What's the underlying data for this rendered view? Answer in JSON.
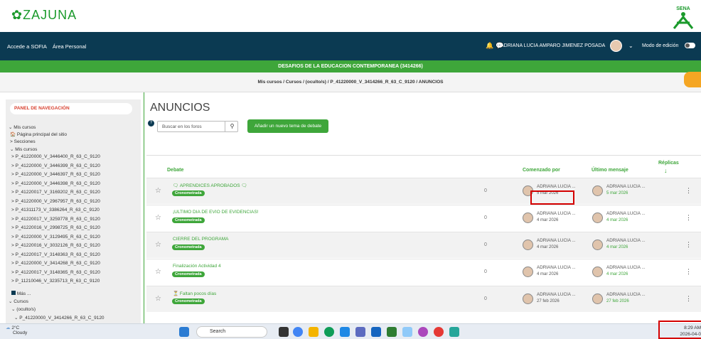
{
  "logo": {
    "text": "ZAJUNA",
    "sena_label": "SENA"
  },
  "topnav": {
    "link1": "Accede a SOFIA",
    "link2": "Área Personal",
    "user": "ADRIANA LUCIA AMPARO JIMENEZ POSADA",
    "edit_mode": "Modo de edición"
  },
  "course_title": "DESAFIOS DE LA EDUCACION CONTEMPORANEA (3414266)",
  "breadcrumb": "Mis cursos / Cursos / (oculto/s) / P_41220000_V_3414266_R_63_C_9120 / ANUNCIOS",
  "sidebar": {
    "title": "PANEL DE NAVEGACIÓN",
    "my_courses": "Mis cursos",
    "home": "Página principal del sitio",
    "sections": "Secciones",
    "my_courses2": "Mis cursos",
    "courses": [
      "P_41220000_V_3446400_R_63_C_9120",
      "P_41220000_V_3446399_R_63_C_9120",
      "P_41220000_V_3446397_R_63_C_9120",
      "P_41220000_V_3446398_R_63_C_9120",
      "P_41220017_V_3169202_R_63_C_9120",
      "P_41220000_V_2967957_R_63_C_9120",
      "P_41311173_V_3386264_R_63_C_9120",
      "P_41220017_V_3259778_R_63_C_9120",
      "P_41220016_V_2998725_R_63_C_9120",
      "P_41220000_V_3129495_R_63_C_9120",
      "P_41220016_V_3032126_R_63_C_9120",
      "P_41220017_V_3148363_R_63_C_9120",
      "P_41220000_V_3414268_R_63_C_9120",
      "P_41220017_V_3148365_R_63_C_9120",
      "P_11210046_V_3235713_R_63_C_9120"
    ],
    "more": "Más ...",
    "cursos": "Cursos",
    "hidden": "(oculto/s)",
    "current": "P_41220000_V_3414266_R_63_C_9120"
  },
  "page_title": "ANUNCIOS",
  "search_placeholder": "Buscar en los foros",
  "add_button": "Añadir un nuevo tema de debate",
  "table": {
    "col_debate": "Debate",
    "col_started": "Comenzado por",
    "col_last": "Último mensaje",
    "col_replies": "Réplicas"
  },
  "badge": "Cronometrada",
  "rows": [
    {
      "title": "🗨 APRENDICES APROBADOS 🗨",
      "author": "ADRIANA LUCIA ...",
      "date": "5 mar 2026",
      "last_author": "ADRIANA LUCIA ...",
      "last_date": "5 mar 2026",
      "replies": "0"
    },
    {
      "title": "¡ULTIMO DIA DE EVIO DE EVIDENCIAS!",
      "author": "ADRIANA LUCIA ...",
      "date": "4 mar 2026",
      "last_author": "ADRIANA LUCIA ...",
      "last_date": "4 mar 2026",
      "replies": "0"
    },
    {
      "title": "CIERRE DEL PROGRAMA",
      "author": "ADRIANA LUCIA ...",
      "date": "4 mar 2026",
      "last_author": "ADRIANA LUCIA ...",
      "last_date": "4 mar 2026",
      "replies": "0"
    },
    {
      "title": "Finalización Actividad 4",
      "author": "ADRIANA LUCIA ...",
      "date": "4 mar 2026",
      "last_author": "ADRIANA LUCIA ...",
      "last_date": "4 mar 2026",
      "replies": "0"
    },
    {
      "title": "⏳ Faltan pocos días",
      "author": "ADRIANA LUCIA ...",
      "date": "27 feb 2026",
      "last_author": "ADRIANA LUCIA ...",
      "last_date": "27 feb 2026",
      "replies": "0"
    }
  ],
  "taskbar": {
    "temp": "2°C",
    "weather": "Cloudy",
    "search": "Search",
    "time": "8:29 AM",
    "date": "2026-04-0"
  }
}
